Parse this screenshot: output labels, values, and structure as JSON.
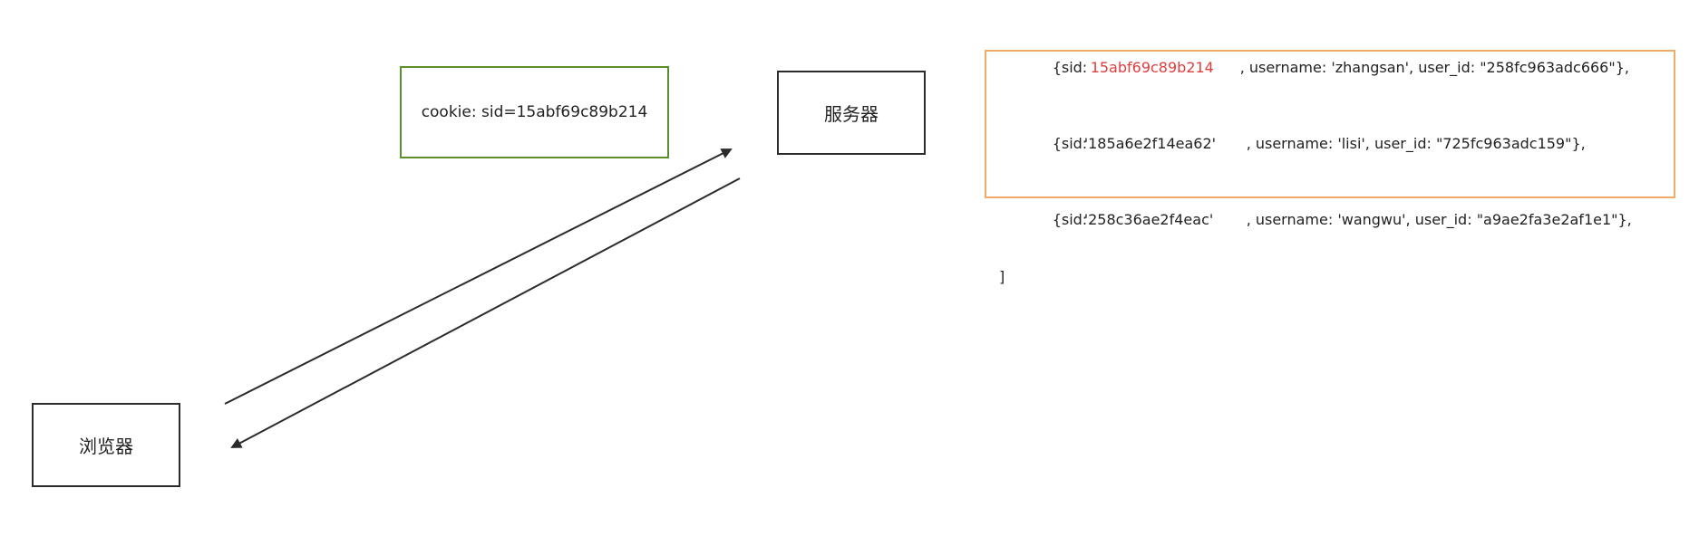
{
  "nodes": {
    "browser": {
      "label": "浏览器"
    },
    "server": {
      "label": "服务器"
    },
    "cookie": {
      "label": "cookie: sid=15abf69c89b214"
    }
  },
  "session_store": {
    "open_bracket": "[",
    "close_bracket": "]",
    "rows": [
      {
        "sid_prefix": "{sid: ",
        "sid_value": "15abf69c89b214",
        "sid_highlighted": true,
        "rest": ", username: 'zhangsan', user_id: \"258fc963adc666\"},"
      },
      {
        "sid_prefix": "{sid: ",
        "sid_value": "'185a6e2f14ea62'",
        "sid_highlighted": false,
        "rest": ", username: 'lisi', user_id: \"725fc963adc159\"},"
      },
      {
        "sid_prefix": "{sid: ",
        "sid_value": "'258c36ae2f4eac'",
        "sid_highlighted": false,
        "rest": ", username: 'wangwu', user_id: \"a9ae2fa3e2af1e1\"},"
      }
    ]
  },
  "colors": {
    "node_border": "#2b2b2b",
    "cookie_border": "#5a8f2e",
    "store_border": "#f1aa6a",
    "highlight": "#e03d3d",
    "edge": "#2b2b2b"
  }
}
